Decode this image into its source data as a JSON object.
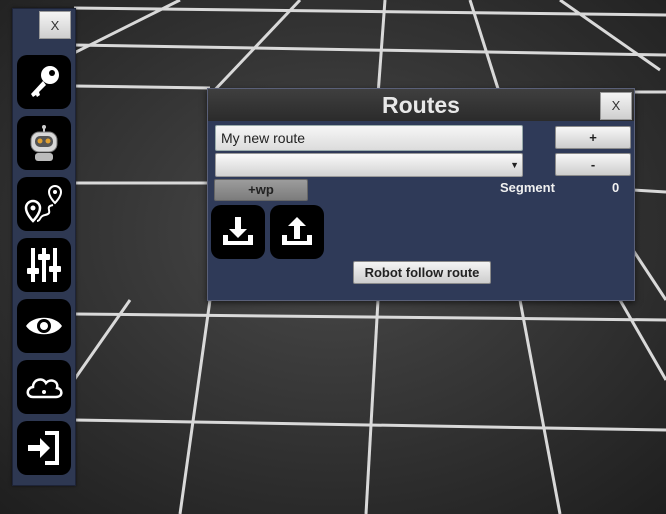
{
  "toolbar": {
    "close_label": "X",
    "buttons": [
      {
        "icon": "key-icon"
      },
      {
        "icon": "robot-icon"
      },
      {
        "icon": "route-pin-icon"
      },
      {
        "icon": "sliders-icon"
      },
      {
        "icon": "eye-icon"
      },
      {
        "icon": "cloud-icon"
      },
      {
        "icon": "sign-in-icon"
      }
    ]
  },
  "routes": {
    "title": "Routes",
    "close_label": "X",
    "route_name": "My new route",
    "route_select_value": "",
    "add_route_label": "+",
    "remove_route_label": "-",
    "add_waypoint_label": "+wp",
    "segment_label": "Segment",
    "segment_value": "0",
    "download_icon": "download-icon",
    "upload_icon": "upload-icon",
    "follow_label": "Robot follow route"
  },
  "colors": {
    "panel": "#2f3a58",
    "floor_grid": "#ffffff",
    "floor": "#3a3a3a"
  }
}
